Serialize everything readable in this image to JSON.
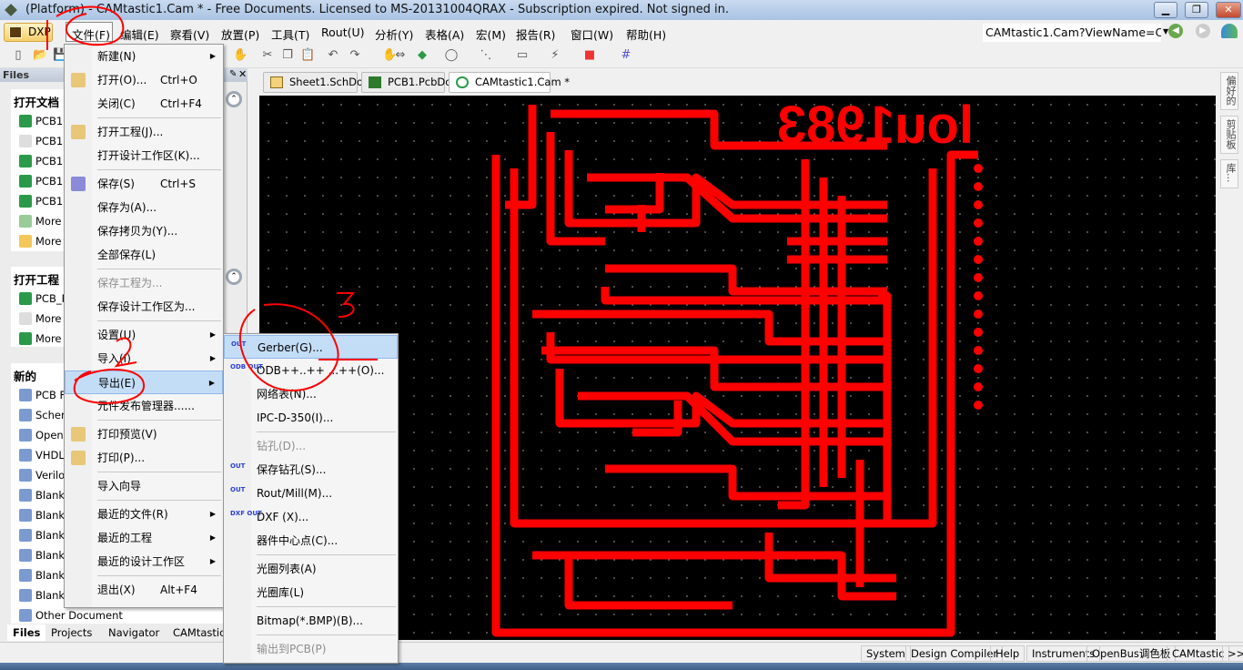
{
  "window": {
    "title": "(Platform) - CAMtastic1.Cam * - Free Documents. Licensed to MS-20131004QRAX - Subscription expired. Not signed in.",
    "controls": [
      "minimize",
      "restore",
      "close"
    ]
  },
  "menubar": {
    "dxp": "DXP",
    "items": [
      "文件(F)",
      "编辑(E)",
      "察看(V)",
      "放置(P)",
      "工具(T)",
      "Rout(U)",
      "分析(Y)",
      "表格(A)",
      "宏(M)",
      "报告(R)",
      "窗口(W)",
      "帮助(H)"
    ]
  },
  "toolbar": {
    "view_combo": "CAMtastic1.Cam?ViewName=C",
    "icons": [
      "new-file",
      "open-folder",
      "save",
      "hand",
      "cut",
      "copy",
      "paste",
      "undo",
      "redo",
      "pan",
      "measure",
      "layer",
      "arc",
      "net",
      "rect",
      "probe",
      "pad",
      "grid"
    ]
  },
  "files_panel": {
    "header": "Files",
    "open_docs": {
      "title": "打开文档",
      "items": [
        "PCB1.",
        "PCB1.7",
        "PCB1.",
        "PCB1.",
        "PCB1.",
        "More F",
        "More D"
      ]
    },
    "open_projects": {
      "title": "打开工程",
      "items": [
        "PCB_P",
        "More F",
        "More F"
      ]
    },
    "new": {
      "title": "新的",
      "items": [
        "PCB Fi",
        "Schem",
        "OpenB",
        "VHDL F",
        "Verilog",
        "Blank F",
        "Blank F",
        "Blank F",
        "Blank F",
        "Blank F",
        "Blank S",
        "Other Document"
      ]
    },
    "tabs": [
      "Files",
      "Projects",
      "Navigator",
      "CAMtastic"
    ],
    "active_tab": "Files"
  },
  "doc_tabs": [
    {
      "label": "Sheet1.SchDoc"
    },
    {
      "label": "PCB1.PcbDoc"
    },
    {
      "label": "CAMtastic1.Cam *",
      "active": true
    }
  ],
  "right_panels": [
    "偏好的",
    "剪贴板",
    "库..."
  ],
  "pcb": {
    "silkscreen_text": "lou1983",
    "trace_color": "#ff0000",
    "background": "#000000"
  },
  "file_menu": [
    {
      "label": "新建(N)",
      "submenu": true
    },
    {
      "label": "打开(O)...",
      "shortcut": "Ctrl+O",
      "icon": "open-folder"
    },
    {
      "label": "关闭(C)",
      "shortcut": "Ctrl+F4"
    },
    {
      "sep": true
    },
    {
      "label": "打开工程(J)...",
      "icon": "open-project"
    },
    {
      "label": "打开设计工作区(K)..."
    },
    {
      "sep": true
    },
    {
      "label": "保存(S)",
      "shortcut": "Ctrl+S",
      "icon": "save"
    },
    {
      "label": "保存为(A)..."
    },
    {
      "label": "保存拷贝为(Y)..."
    },
    {
      "label": "全部保存(L)"
    },
    {
      "sep": true
    },
    {
      "label": "保存工程为...",
      "disabled": true
    },
    {
      "label": "保存设计工作区为..."
    },
    {
      "sep": true
    },
    {
      "label": "设置(U)",
      "submenu": true
    },
    {
      "label": "导入(I)",
      "submenu": true
    },
    {
      "label": "导出(E)",
      "submenu": true,
      "highlighted": true
    },
    {
      "label": "元件发布管理器......"
    },
    {
      "sep": true
    },
    {
      "label": "打印预览(V)",
      "icon": "print-preview"
    },
    {
      "label": "打印(P)...",
      "icon": "printer"
    },
    {
      "sep": true
    },
    {
      "label": "导入向导"
    },
    {
      "sep": true
    },
    {
      "label": "最近的文件(R)",
      "submenu": true
    },
    {
      "label": "最近的工程",
      "submenu": true
    },
    {
      "label": "最近的设计工作区",
      "submenu": true
    },
    {
      "sep": true
    },
    {
      "label": "退出(X)",
      "shortcut": "Alt+F4"
    }
  ],
  "export_menu": [
    {
      "label": "Gerber(G)...",
      "highlighted": true,
      "icon": "gerber-out",
      "icon_text": "OUT"
    },
    {
      "label": "ODB++..++ ...++(O)...",
      "icon": "odb-out",
      "icon_text": "ODB OUT"
    },
    {
      "label": "网络表(N)..."
    },
    {
      "label": "IPC-D-350(I)..."
    },
    {
      "sep": true
    },
    {
      "label": "钻孔(D)...",
      "disabled": true
    },
    {
      "label": "保存钻孔(S)...",
      "icon": "drill-out",
      "icon_text": "OUT"
    },
    {
      "label": "Rout/Mill(M)...",
      "icon": "mill-out",
      "icon_text": "OUT"
    },
    {
      "label": "DXF (X)...",
      "icon": "dxf-out",
      "icon_text": "DXF OUT"
    },
    {
      "label": "器件中心点(C)..."
    },
    {
      "sep": true
    },
    {
      "label": "光圈列表(A)"
    },
    {
      "label": "光圈库(L)"
    },
    {
      "sep": true
    },
    {
      "label": "Bitmap(*.BMP)(B)..."
    },
    {
      "sep": true
    },
    {
      "label": "输出到PCB(P)",
      "disabled": true
    }
  ],
  "statusbar": [
    "System",
    "Design Compiler",
    "Help",
    "Instruments",
    "OpenBus调色板",
    "CAMtastic",
    ">>"
  ],
  "annotations": {
    "color": "#ff0000",
    "marks": [
      "2",
      "3"
    ]
  }
}
